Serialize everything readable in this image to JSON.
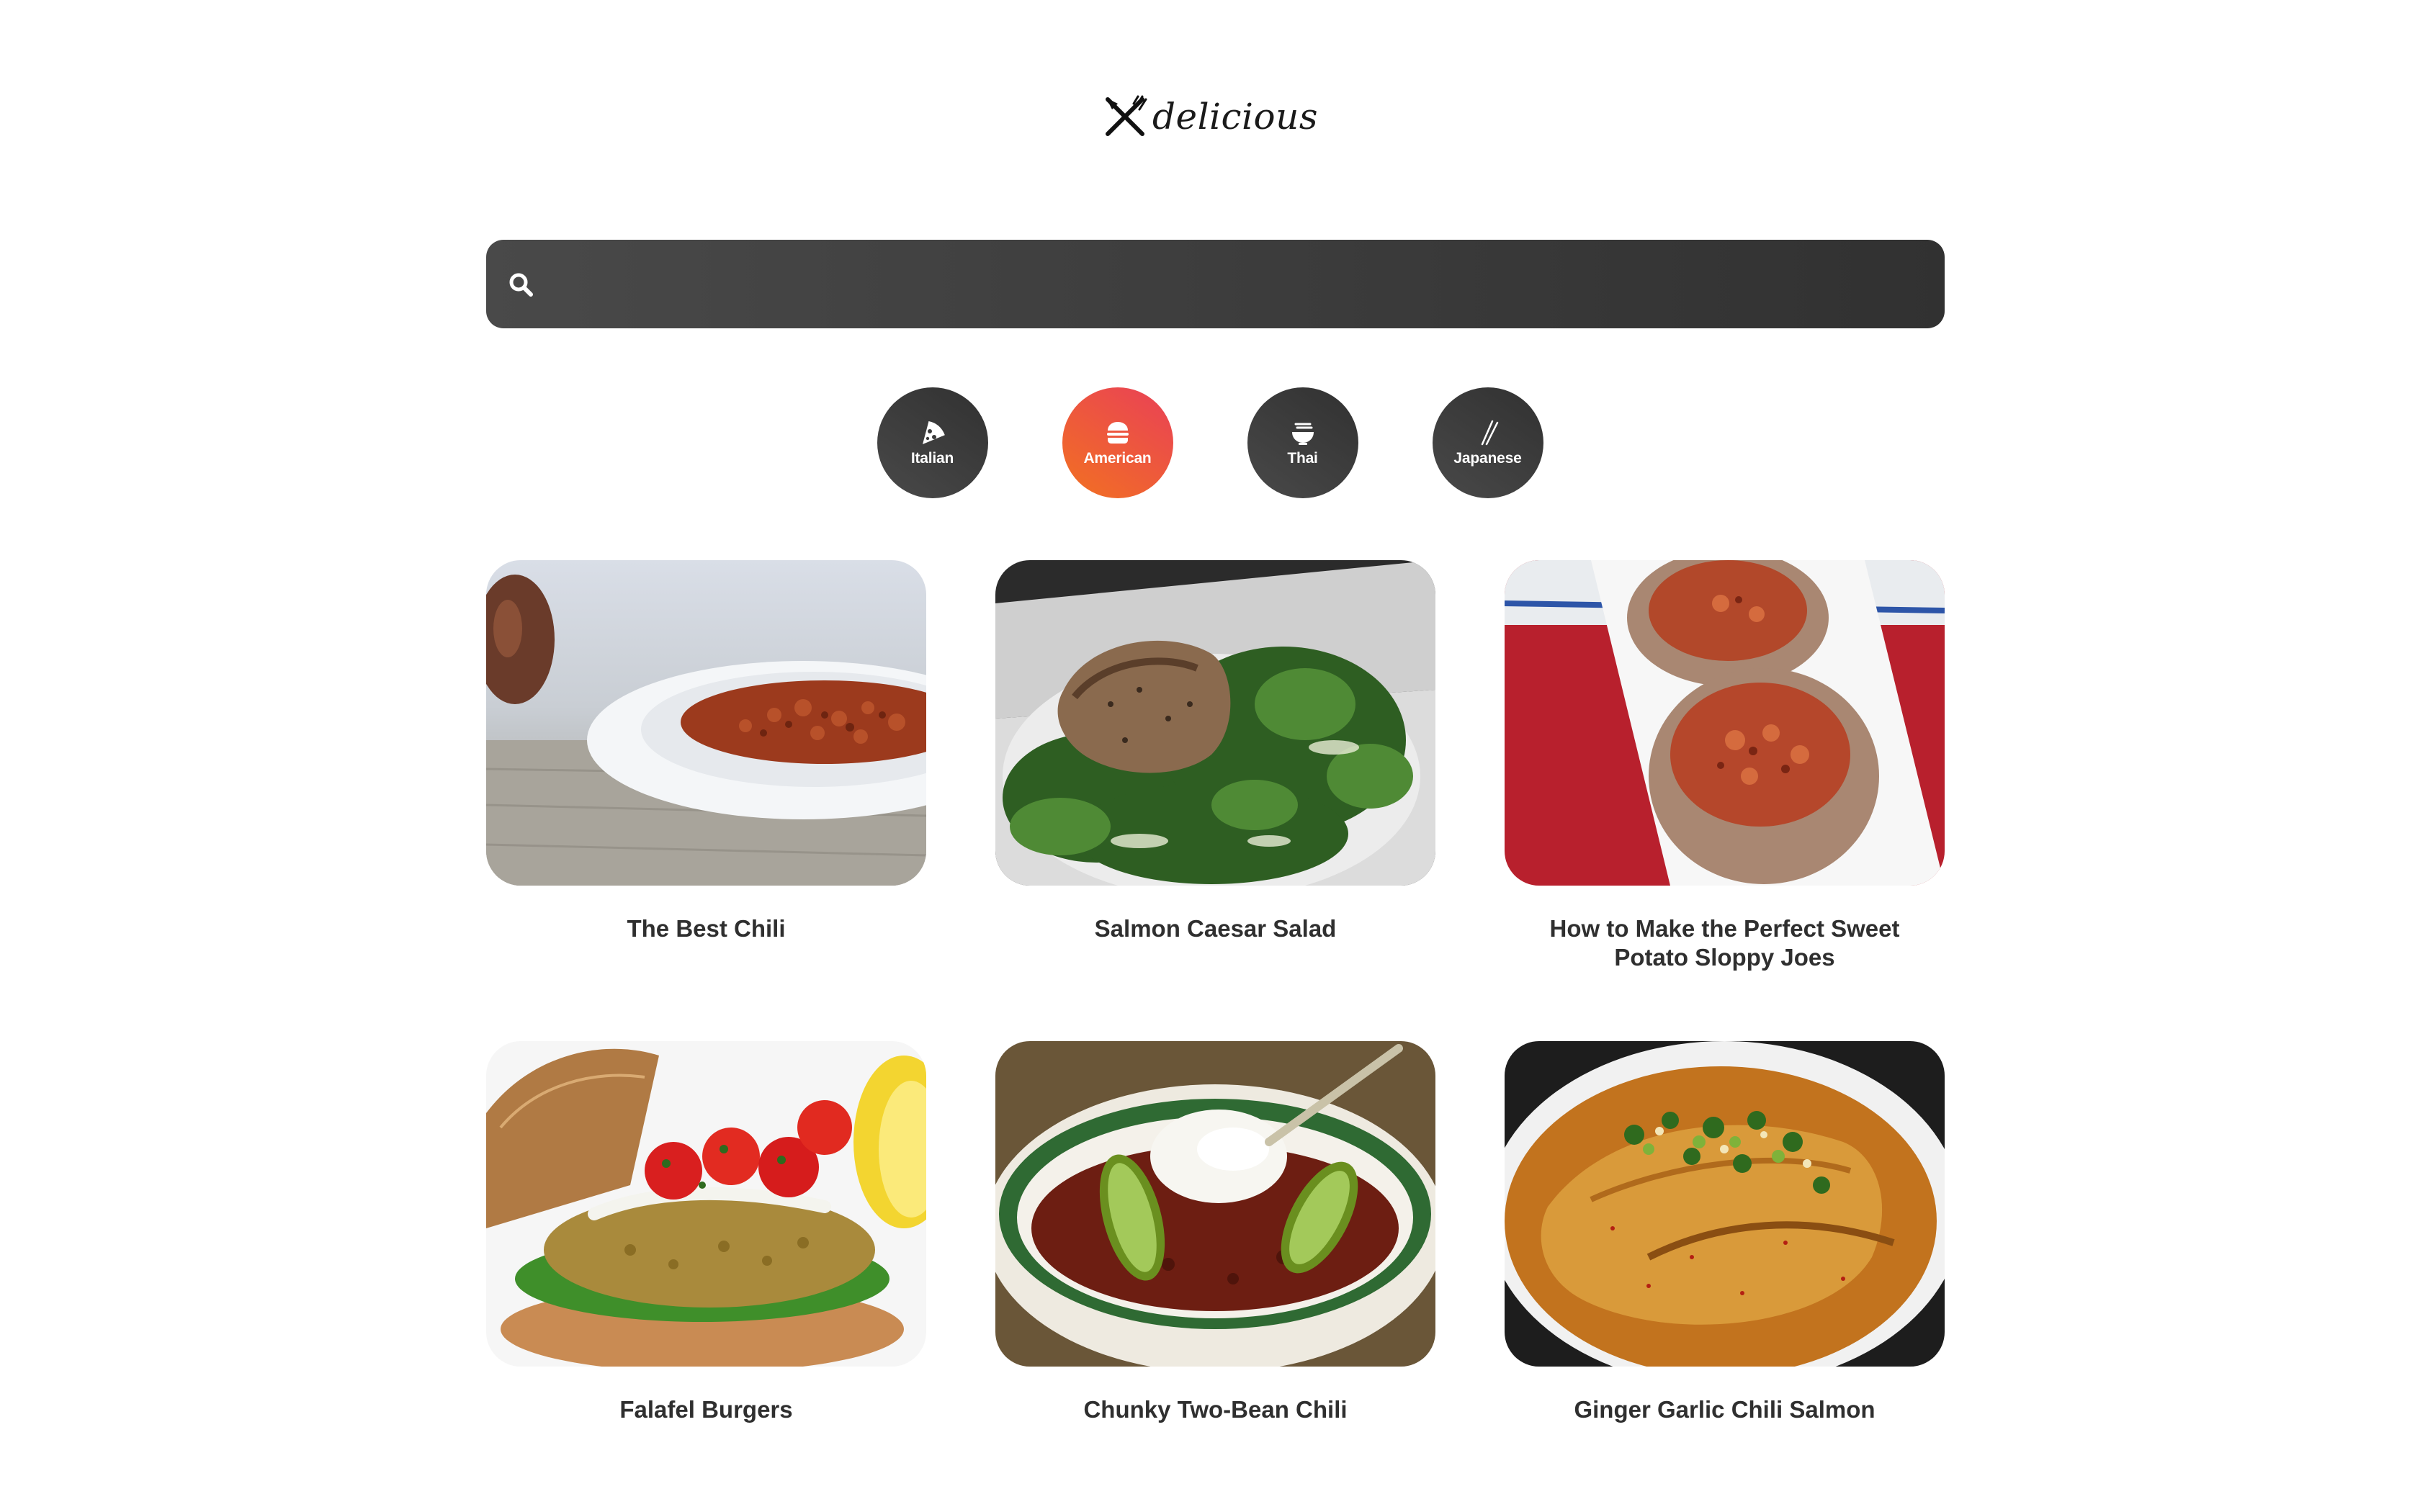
{
  "logo": {
    "text": "delicious",
    "icon": "fork-knife-crossed-icon"
  },
  "search": {
    "value": "",
    "placeholder": "",
    "icon": "search-icon"
  },
  "categories": [
    {
      "label": "Italian",
      "icon": "pizza-icon",
      "active": false
    },
    {
      "label": "American",
      "icon": "burger-icon",
      "active": true
    },
    {
      "label": "Thai",
      "icon": "noodle-bowl-icon",
      "active": false
    },
    {
      "label": "Japanese",
      "icon": "chopsticks-icon",
      "active": false
    }
  ],
  "colors": {
    "dark_gradient": [
      "#494949",
      "#313131"
    ],
    "active_gradient": [
      "#f27121",
      "#e94057"
    ]
  },
  "recipes": [
    {
      "title": "The Best Chili",
      "image": "chili-bowl-photo"
    },
    {
      "title": "Salmon Caesar Salad",
      "image": "salmon-caesar-salad-photo"
    },
    {
      "title": "How to Make the Perfect Sweet Potato Sloppy Joes",
      "image": "sweet-potato-sloppy-joes-photo"
    },
    {
      "title": "Falafel Burgers",
      "image": "falafel-burger-photo"
    },
    {
      "title": "Chunky Two-Bean Chili",
      "image": "two-bean-chili-photo"
    },
    {
      "title": "Ginger Garlic Chili Salmon",
      "image": "ginger-garlic-salmon-photo"
    }
  ]
}
